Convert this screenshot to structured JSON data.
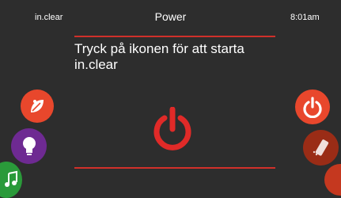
{
  "status_bar": {
    "device": "in.clear",
    "title": "Power",
    "time": "8:01am"
  },
  "message": {
    "line1": "Tryck på ikonen för att starta",
    "line2": "in.clear"
  },
  "colors": {
    "accent_red": "#e8472c",
    "line_red": "#d0302a",
    "background": "#2d2d2d",
    "purple": "#6e2a92",
    "green": "#2a9a3a"
  },
  "icons": {
    "main": "power-icon",
    "left_nav": [
      "eco-leaf-icon",
      "lightbulb-icon",
      "music-icon"
    ],
    "right_nav": [
      "power-icon",
      "remote-control-icon",
      "partial-icon"
    ]
  }
}
